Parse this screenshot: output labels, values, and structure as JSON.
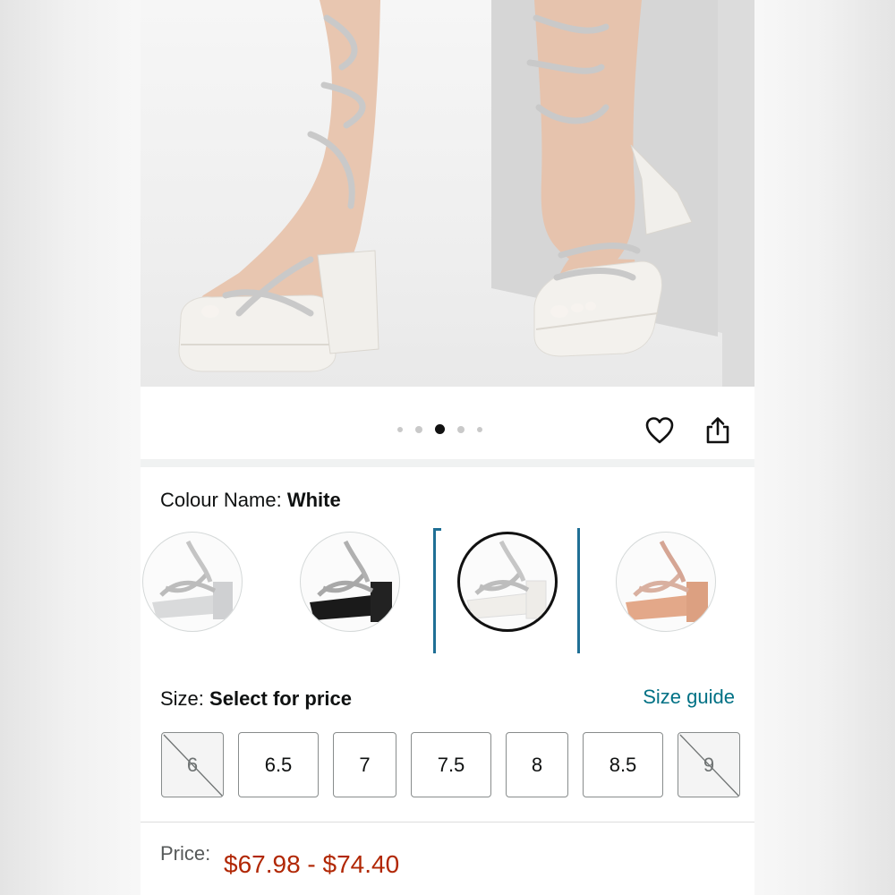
{
  "carousel": {
    "dot_count": 5,
    "active_index": 2
  },
  "actions": {
    "wishlist_icon": "heart-icon",
    "share_icon": "share-icon"
  },
  "colour": {
    "label": "Colour Name:",
    "value": "White",
    "swatches": [
      {
        "name": "Silver",
        "selected": false
      },
      {
        "name": "Black",
        "selected": false
      },
      {
        "name": "White",
        "selected": true
      },
      {
        "name": "Rose Gold",
        "selected": false
      }
    ]
  },
  "size": {
    "label": "Size:",
    "value": "Select for price",
    "guide_link": "Size guide",
    "options": [
      {
        "label": "6",
        "available": false
      },
      {
        "label": "6.5",
        "available": true
      },
      {
        "label": "7",
        "available": true
      },
      {
        "label": "7.5",
        "available": true
      },
      {
        "label": "8",
        "available": true
      },
      {
        "label": "8.5",
        "available": true
      },
      {
        "label": "9",
        "available": false
      }
    ]
  },
  "price": {
    "label": "Price:",
    "value": "$67.98 - $74.40"
  },
  "colors": {
    "price": "#b12704",
    "link": "#007185",
    "selection": "#1f6f95"
  }
}
